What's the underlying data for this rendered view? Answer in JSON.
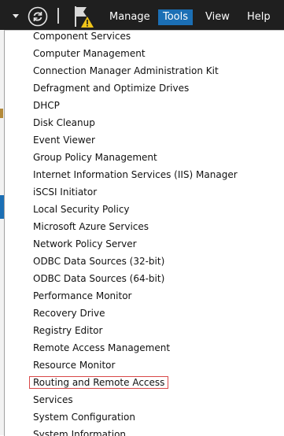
{
  "topbar": {
    "menu": [
      "Manage",
      "Tools",
      "View",
      "Help"
    ],
    "active_menu": "Tools"
  },
  "tools_menu": {
    "items": [
      "Component Services",
      "Computer Management",
      "Connection Manager Administration Kit",
      "Defragment and Optimize Drives",
      "DHCP",
      "Disk Cleanup",
      "Event Viewer",
      "Group Policy Management",
      "Internet Information Services (IIS) Manager",
      "iSCSI Initiator",
      "Local Security Policy",
      "Microsoft Azure Services",
      "Network Policy Server",
      "ODBC Data Sources (32-bit)",
      "ODBC Data Sources (64-bit)",
      "Performance Monitor",
      "Recovery Drive",
      "Registry Editor",
      "Remote Access Management",
      "Resource Monitor",
      "Routing and Remote Access",
      "Services",
      "System Configuration",
      "System Information"
    ],
    "highlighted_item": "Routing and Remote Access"
  }
}
